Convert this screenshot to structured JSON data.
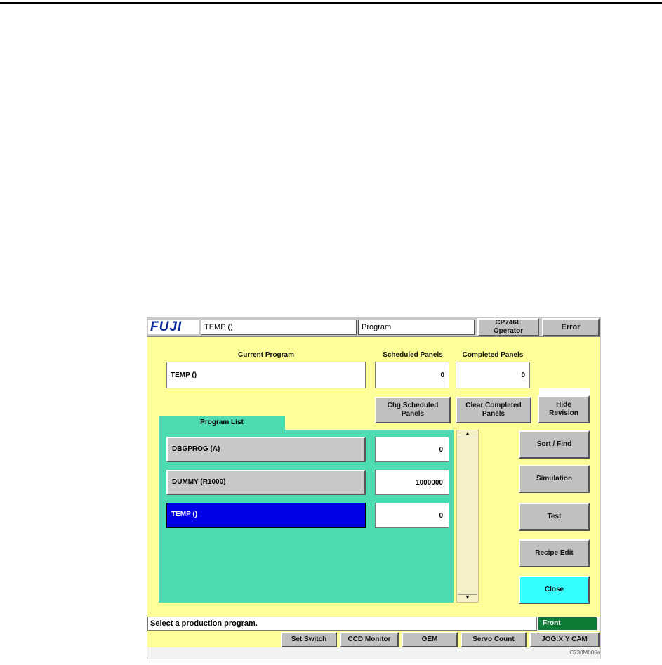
{
  "titlebar": {
    "logo": "FUJI",
    "program_field": "TEMP ()",
    "mode_field": "Program",
    "machine_line1": "CP746E",
    "machine_line2": "Operator",
    "error_button": "Error"
  },
  "current_program": {
    "label": "Current Program",
    "value": "TEMP ()"
  },
  "scheduled": {
    "label": "Scheduled Panels",
    "value": "0",
    "button_line1": "Chg Scheduled",
    "button_line2": "Panels"
  },
  "completed": {
    "label": "Completed Panels",
    "value": "0",
    "button_line1": "Clear Completed",
    "button_line2": "Panels"
  },
  "hide_revision": {
    "line1": "Hide",
    "line2": "Revision"
  },
  "program_list": {
    "tab_label": "Program List",
    "items": [
      {
        "name": "DBGPROG  (A)",
        "count": "0"
      },
      {
        "name": "DUMMY  (R1000)",
        "count": "1000000"
      },
      {
        "name": "TEMP  ()",
        "count": "0"
      }
    ]
  },
  "side_buttons": {
    "sort_find": "Sort / Find",
    "simulation": "Simulation",
    "test": "Test",
    "recipe_edit": "Recipe Edit",
    "close": "Close"
  },
  "status": {
    "message": "Select a production program.",
    "front": "Front"
  },
  "bottom_buttons": {
    "set_switch": "Set Switch",
    "ccd_monitor": "CCD Monitor",
    "gem": "GEM",
    "servo_count": "Servo Count",
    "jog": "JOG:X Y CAM"
  },
  "caption": "C730M005a",
  "colors": {
    "panel_bg": "#ffff99",
    "list_bg": "#4fdbb2",
    "selected": "#0000e6",
    "close_button": "#33ffff",
    "front_indicator": "#0d7a35"
  }
}
